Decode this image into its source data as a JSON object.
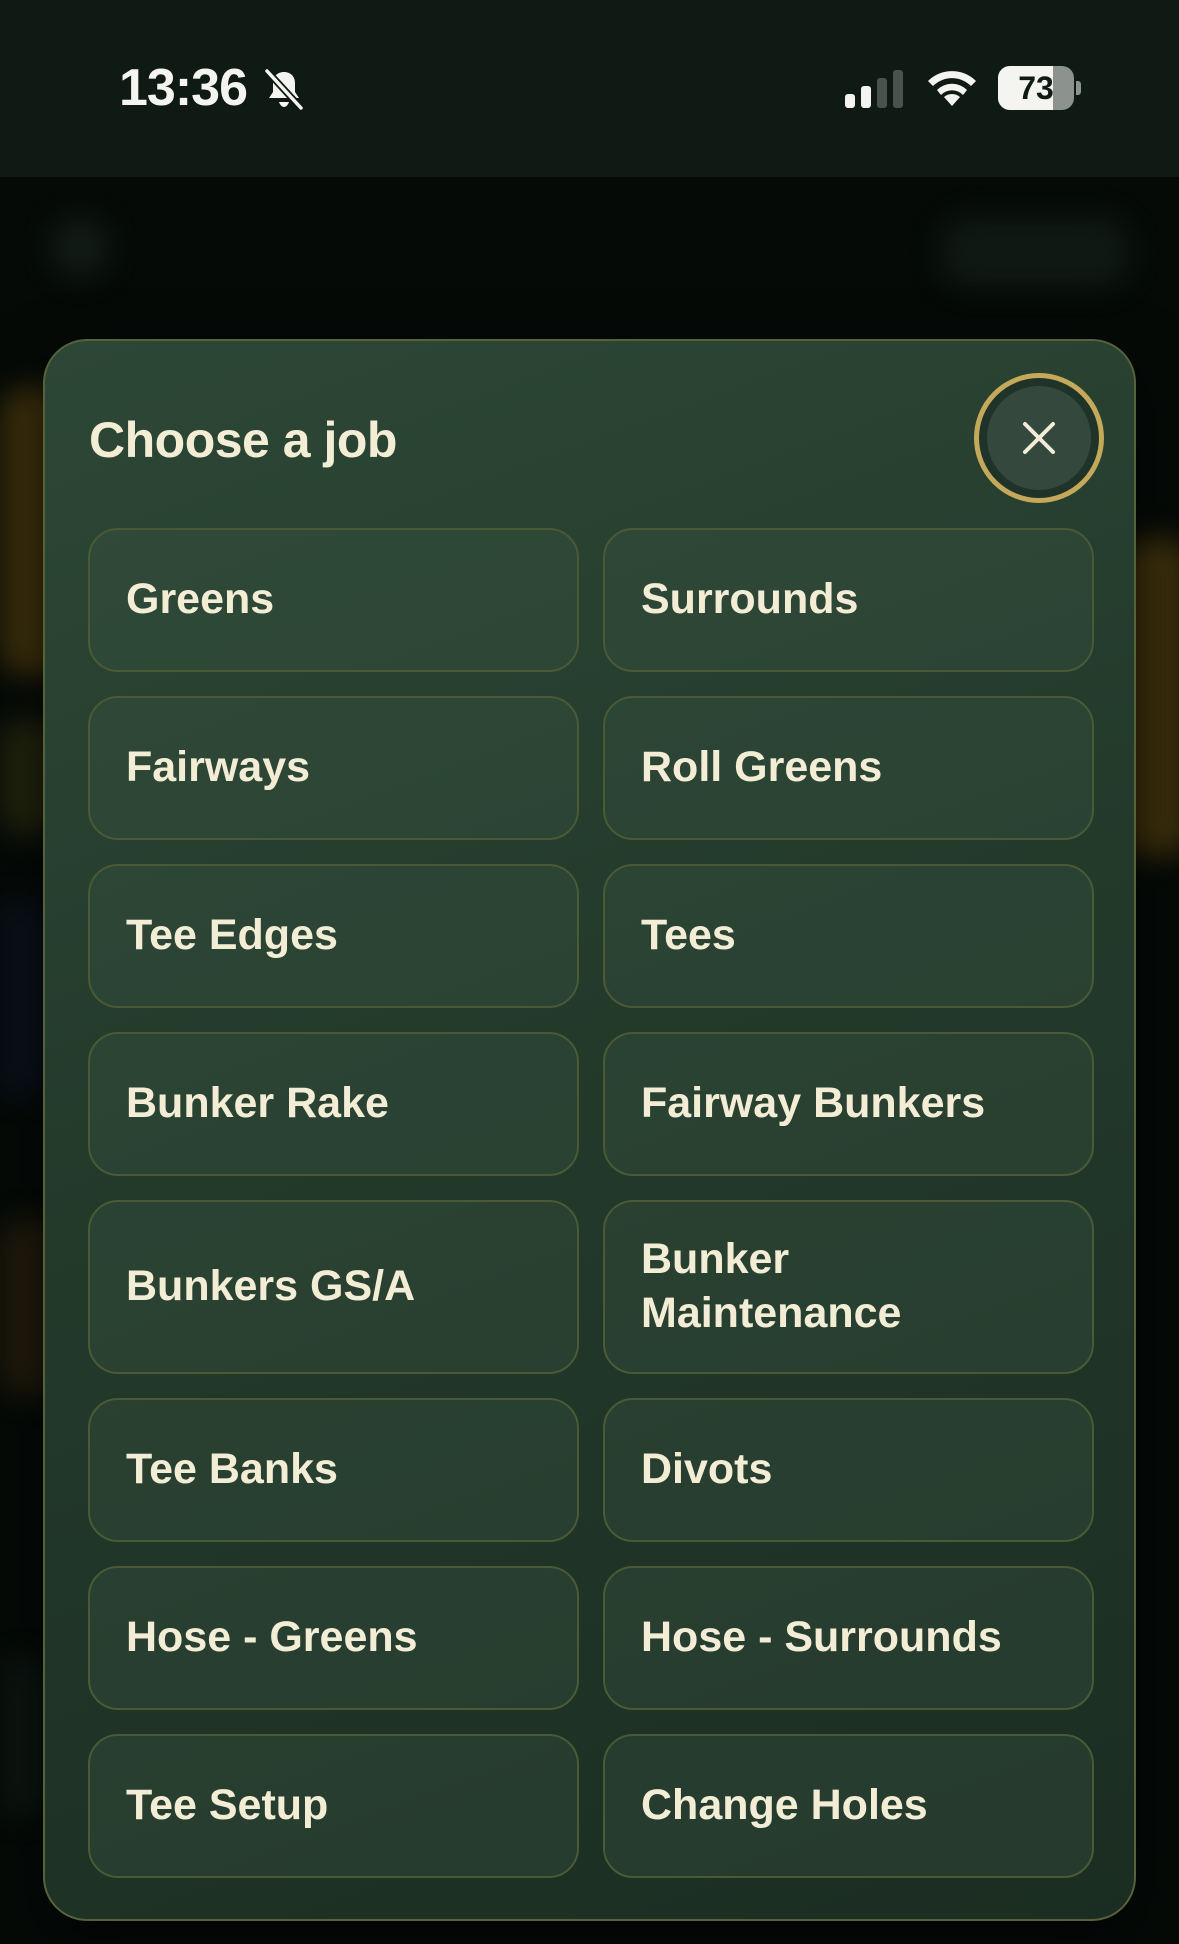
{
  "status_bar": {
    "time": "13:36",
    "battery_level": "73",
    "battery_fraction": 0.73
  },
  "modal": {
    "title": "Choose a job",
    "jobs": [
      "Greens",
      "Surrounds",
      "Fairways",
      "Roll Greens",
      "Tee Edges",
      "Tees",
      "Bunker Rake",
      "Fairway Bunkers",
      "Bunkers GS/A",
      "Bunker Maintenance",
      "Tee Banks",
      "Divots",
      "Hose - Greens",
      "Hose - Surrounds",
      "Tee Setup",
      "Change Holes"
    ]
  },
  "colors": {
    "accent_gold": "#c4a95a",
    "modal_bg": "#233a2b",
    "text": "#f3edd6"
  },
  "icons": [
    "bell-slash-icon",
    "cellular-signal-icon",
    "wifi-icon",
    "battery-icon",
    "close-icon"
  ]
}
